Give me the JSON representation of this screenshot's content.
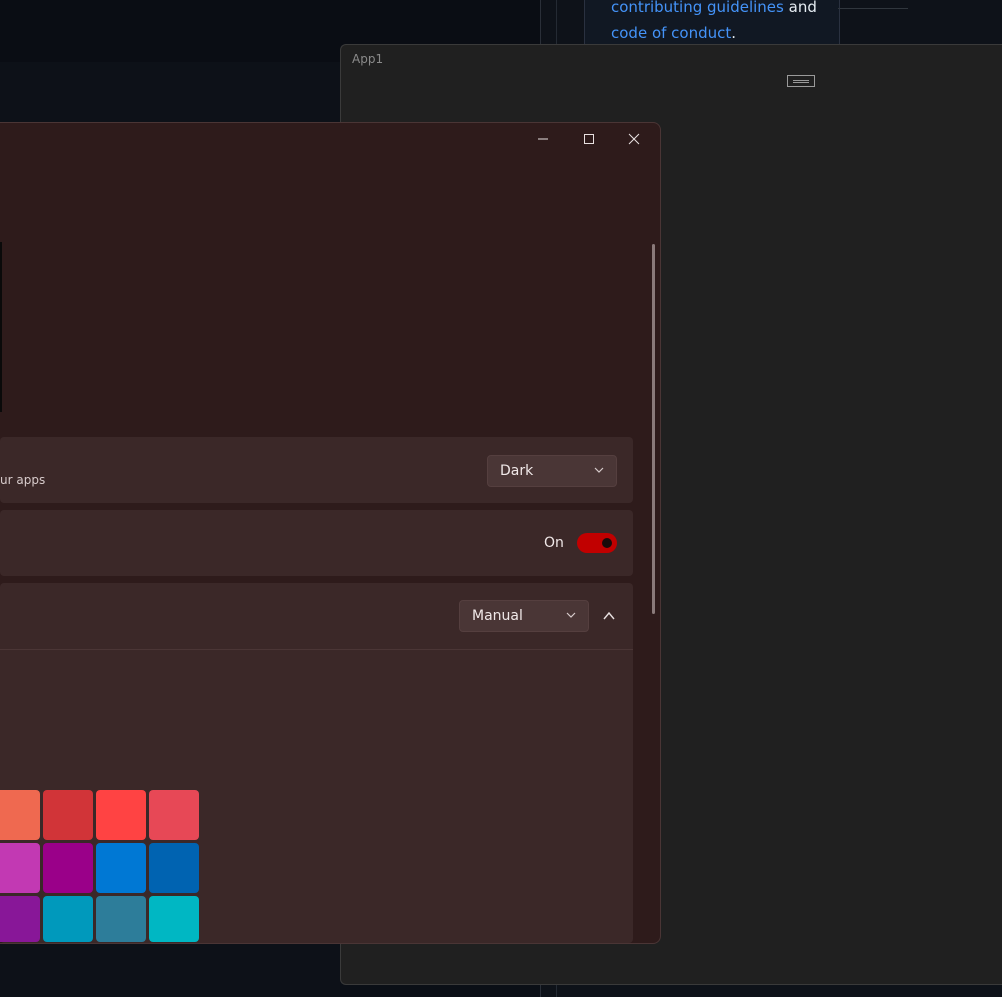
{
  "background": {
    "github_text_line1": "contributing guidelines",
    "github_text_and": "and",
    "github_text_line2": "code of conduct",
    "github_text_period": "."
  },
  "app1": {
    "title": "App1"
  },
  "settings": {
    "app_mode": {
      "description_fragment": "ur apps",
      "value": "Dark"
    },
    "transparency": {
      "state_label": "On"
    },
    "accent": {
      "value": "Manual"
    },
    "swatches": [
      {
        "color": "#ef6950"
      },
      {
        "color": "#d13438"
      },
      {
        "color": "#ff4343"
      },
      {
        "color": "#e74856"
      },
      {
        "color": "#c239b3"
      },
      {
        "color": "#9a0089"
      },
      {
        "color": "#0078d4"
      },
      {
        "color": "#0063b1"
      },
      {
        "color": "#881798"
      },
      {
        "color": "#0099bc"
      },
      {
        "color": "#2d7d9a"
      },
      {
        "color": "#00b7c3"
      }
    ]
  },
  "colors": {
    "accent_toggle": "#c10000",
    "link": "#4493f8"
  }
}
